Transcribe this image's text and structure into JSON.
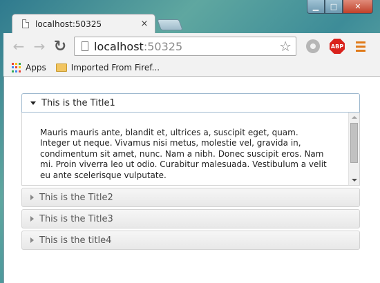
{
  "browser": {
    "tab": {
      "title": "localhost:50325",
      "close_glyph": "×"
    },
    "window_controls": {
      "minimize_glyph": "▁",
      "maximize_glyph": "□",
      "close_glyph": "✕"
    },
    "toolbar": {
      "back_glyph": "←",
      "forward_glyph": "→",
      "reload_glyph": "↻",
      "url_host": "localhost",
      "url_port": ":50325",
      "star_glyph": "☆",
      "abp_label": "ABP"
    },
    "bookmarks": {
      "items": [
        {
          "label": "Apps",
          "icon": "apps-grid-icon"
        },
        {
          "label": "Imported From Firef...",
          "icon": "folder-icon"
        }
      ]
    },
    "colors": {
      "abp_red": "#d9221c",
      "menu_orange": "#e07a19",
      "close_red": "#c0412a"
    }
  },
  "accordion": {
    "sections": [
      {
        "title": "This is the Title1",
        "expanded": true,
        "body": "Mauris mauris ante, blandit et, ultrices a, suscipit eget, quam. Integer ut neque. Vivamus nisi metus, molestie vel, gravida in, condimentum sit amet, nunc. Nam a nibh. Donec suscipit eros. Nam mi. Proin viverra leo ut odio. Curabitur malesuada. Vestibulum a velit eu ante scelerisque vulputate."
      },
      {
        "title": "This is the Title2",
        "expanded": false
      },
      {
        "title": "This is the Title3",
        "expanded": false
      },
      {
        "title": "This is the title4",
        "expanded": false
      }
    ]
  }
}
